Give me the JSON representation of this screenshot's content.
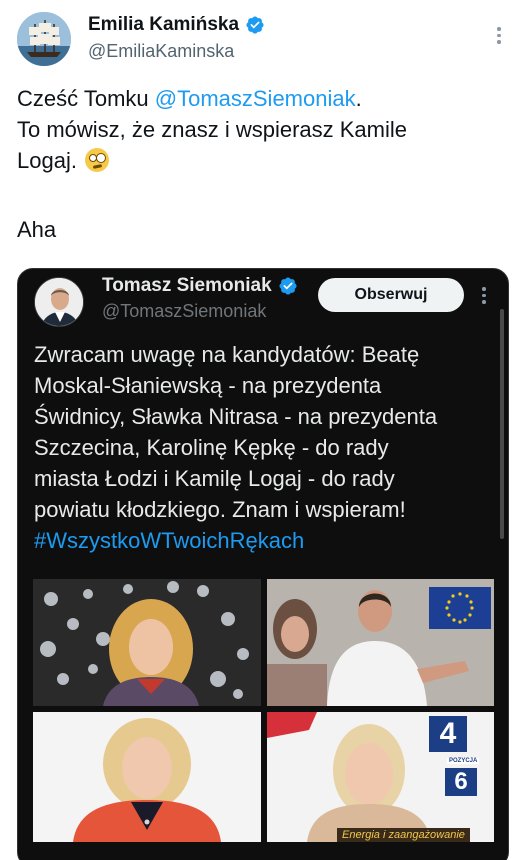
{
  "tweet": {
    "author_name": "Emilia Kamińska",
    "author_handle": "@EmiliaKaminska",
    "text_line1_prefix": "Cześć Tomku ",
    "text_line1_mention": "@TomaszSiemoniak",
    "text_line1_suffix": ".",
    "text_line2": "To mówisz, że znasz i wspierasz Kamile",
    "text_line3": "Logaj. ",
    "emoji": "flushed-face-emoji",
    "text_line4": "Aha"
  },
  "quoted_tweet": {
    "author_name": "Tomasz Siemoniak",
    "author_handle": "@TomaszSiemoniak",
    "follow_label": "Obserwuj",
    "text_lines": [
      "Zwracam uwagę na kandydatów: Beatę",
      "Moskal-Słaniewską - na prezydenta",
      "Świdnicy, Sławka Nitrasa - na prezydenta",
      "Szczecina, Karolinę Kępkę - do rady",
      "miasta Łodzi i Kamilę Logaj - do rady",
      "powiatu kłodzkiego. Znam i wspieram!"
    ],
    "hashtag": "#WszystkoWTwoichRękach",
    "photo_4": {
      "ballot_number_top": "4",
      "ballot_caption": "POZYCJA",
      "ballot_number_bottom": "6",
      "slogan": "Energia i zaangażowanie"
    }
  },
  "colors": {
    "accent": "#1d9bf0",
    "verified": "#1d9bf0",
    "card_background": "#0e0e0e",
    "ballot_blue": "#1b3e84",
    "eu_flag": "#1c3f94"
  },
  "icons": [
    "verified-badge-icon",
    "more-options-icon",
    "flushed-face-emoji"
  ]
}
